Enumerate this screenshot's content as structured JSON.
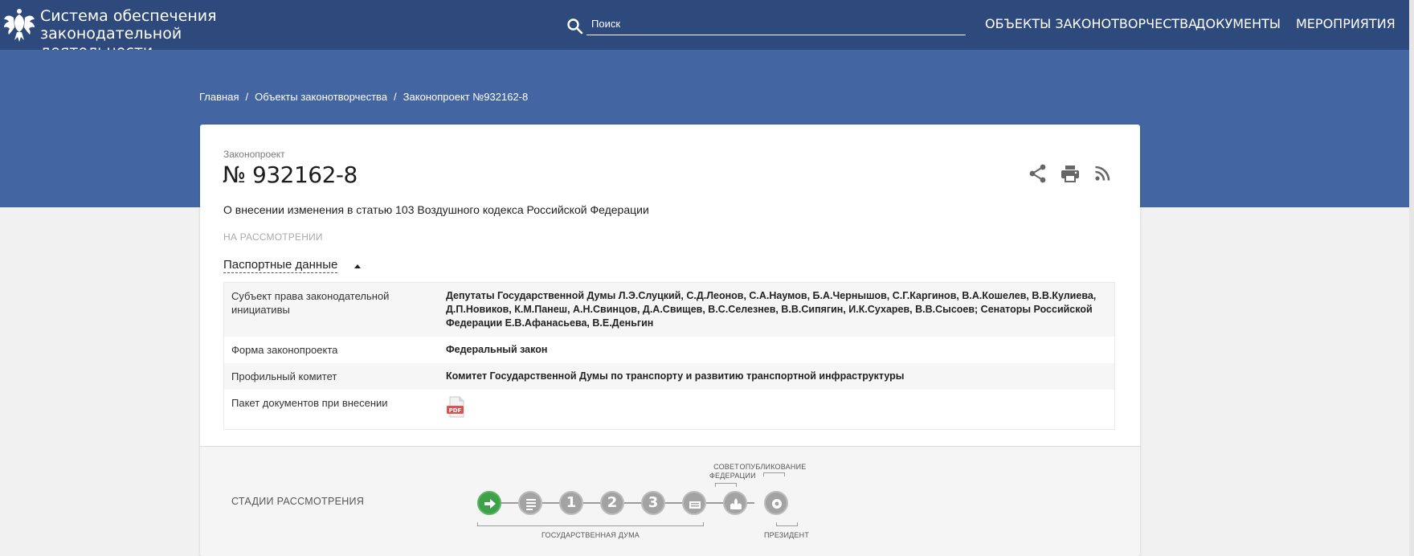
{
  "header": {
    "site_title_line1": "Система обеспечения",
    "site_title_line2": "законодательной деятельности",
    "search_placeholder": "Поиск",
    "nav": [
      "ОБЪЕКТЫ ЗАКОНОТВОРЧЕСТВА",
      "ДОКУМЕНТЫ",
      "МЕРОПРИЯТИЯ"
    ]
  },
  "breadcrumb": [
    "Главная",
    "Объекты законотворчества",
    "Законопроект №932162-8"
  ],
  "bill": {
    "type": "Законопроект",
    "number": "№ 932162-8",
    "title": "О внесении изменения в статью 103 Воздушного кодекса Российской Федерации",
    "status": "НА РАССМОТРЕНИИ",
    "passport_label": "Паспортные данные",
    "actions": [
      "share-icon",
      "print-icon",
      "rss-icon"
    ]
  },
  "passport": [
    {
      "key": "Субъект права законодательной инициативы",
      "value": "Депутаты Государственной Думы Л.Э.Слуцкий, С.Д.Леонов, С.А.Наумов, Б.А.Чернышов, С.Г.Каргинов, В.А.Кошелев, В.В.Кулиева, Д.П.Новиков, К.М.Панеш, А.Н.Свинцов, Д.А.Свищев, В.С.Селезнев, В.В.Сипягин, И.К.Сухарев, В.В.Сысоев; Сенаторы Российской Федерации Е.В.Афанасьева, В.Е.Деньгин"
    },
    {
      "key": "Форма законопроекта",
      "value": "Федеральный закон"
    },
    {
      "key": "Профильный комитет",
      "value": "Комитет Государственной Думы по транспорту и развитию транспортной инфраструктуры"
    },
    {
      "key": "Пакет документов при внесении",
      "value": "",
      "icon": "pdf-icon"
    }
  ],
  "stages": {
    "label": "СТАДИИ РАССМОТРЕНИЯ",
    "items": [
      "arrow",
      "list",
      "1",
      "2",
      "3",
      "council",
      "president",
      "emblem"
    ],
    "active_index": 0,
    "captions": {
      "duma": "ГОСУДАРСТВЕННАЯ ДУМА",
      "council_1": "СОВЕТ",
      "council_2": "ФЕДЕРАЦИИ",
      "publication": "ОПУБЛИКОВАНИЕ",
      "president": "ПРЕЗИДЕНТ"
    }
  },
  "colors": {
    "topbar": "#2e4a7d",
    "band": "#4366a2",
    "stage_active": "#3ea048",
    "stage_inactive": "#a3a3a3",
    "pdf": "#d9534f"
  }
}
